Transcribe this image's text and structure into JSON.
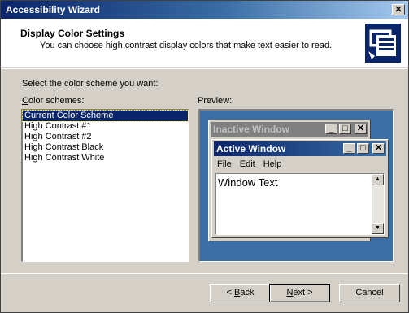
{
  "window": {
    "title": "Accessibility Wizard"
  },
  "header": {
    "title": "Display Color Settings",
    "subtitle": "You can choose high contrast display colors that make text easier to read.",
    "icon": "accessibility-wizard-icon"
  },
  "prompt": "Select the color scheme you want:",
  "schemes": {
    "label_first": "C",
    "label_rest": "olor schemes:",
    "items": [
      {
        "label": "Current Color Scheme",
        "selected": true
      },
      {
        "label": "High Contrast #1",
        "selected": false
      },
      {
        "label": "High Contrast #2",
        "selected": false
      },
      {
        "label": "High Contrast Black",
        "selected": false
      },
      {
        "label": "High Contrast White",
        "selected": false
      }
    ]
  },
  "preview": {
    "label": "Preview:",
    "inactive_title": "Inactive Window",
    "active_title": "Active Window",
    "menu": [
      "File",
      "Edit",
      "Help"
    ],
    "window_text": "Window Text"
  },
  "buttons": {
    "back": "< ",
    "back_ul": "B",
    "back_rest": "ack",
    "next_ul": "N",
    "next_rest": "ext >",
    "cancel": "Cancel"
  },
  "colors": {
    "title_active_start": "#0a246a",
    "title_active_end": "#a6caf0",
    "preview_bg": "#3a6ea5",
    "face": "#d4d0c8",
    "selection": "#0a246a"
  }
}
